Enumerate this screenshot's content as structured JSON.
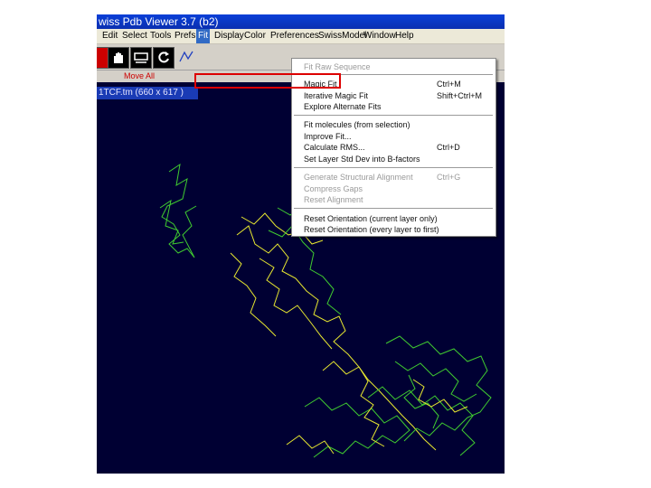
{
  "window": {
    "title": "wiss Pdb Viewer 3.7 (b2)"
  },
  "menubar": {
    "items": [
      {
        "label": "Edit"
      },
      {
        "label": "Select"
      },
      {
        "label": "Tools"
      },
      {
        "label": "Prefs"
      },
      {
        "label": "Fit"
      },
      {
        "label": "Display"
      },
      {
        "label": "Color"
      },
      {
        "label": "Preferences"
      },
      {
        "label": "SwissModel"
      },
      {
        "label": "Window"
      },
      {
        "label": "Help"
      }
    ],
    "active": "Fit"
  },
  "toolbar": {
    "move_label": "Move All"
  },
  "view": {
    "title": "1TCF.tm   (660 x 617 )"
  },
  "fit_menu": {
    "header": "Fit Raw Sequence",
    "items": [
      {
        "label": "Magic Fit",
        "shortcut": "Ctrl+M",
        "enabled": true
      },
      {
        "label": "Iterative Magic Fit",
        "shortcut": "Shift+Ctrl+M",
        "enabled": true
      },
      {
        "label": "Explore Alternate Fits",
        "shortcut": "",
        "enabled": true
      },
      {
        "label": "Fit molecules (from selection)",
        "shortcut": "",
        "enabled": true
      },
      {
        "label": "Improve Fit...",
        "shortcut": "",
        "enabled": true
      },
      {
        "label": "Calculate RMS...",
        "shortcut": "Ctrl+D",
        "enabled": true
      },
      {
        "label": "Set Layer Std Dev into B-factors",
        "shortcut": "",
        "enabled": true
      },
      {
        "label": "Generate Structural Alignment",
        "shortcut": "Ctrl+G",
        "enabled": false
      },
      {
        "label": "Compress Gaps",
        "shortcut": "",
        "enabled": false
      },
      {
        "label": "Reset Alignment",
        "shortcut": "",
        "enabled": false
      },
      {
        "label": "Reset Orientation (current layer only)",
        "shortcut": "",
        "enabled": true
      },
      {
        "label": "Reset Orientation (every layer to first)",
        "shortcut": "",
        "enabled": true
      }
    ]
  },
  "colors": {
    "background": "#000033",
    "chain_a": "#e8e830",
    "chain_b": "#40cc30",
    "highlight": "#dd0000",
    "menu_active": "#316ac5"
  }
}
